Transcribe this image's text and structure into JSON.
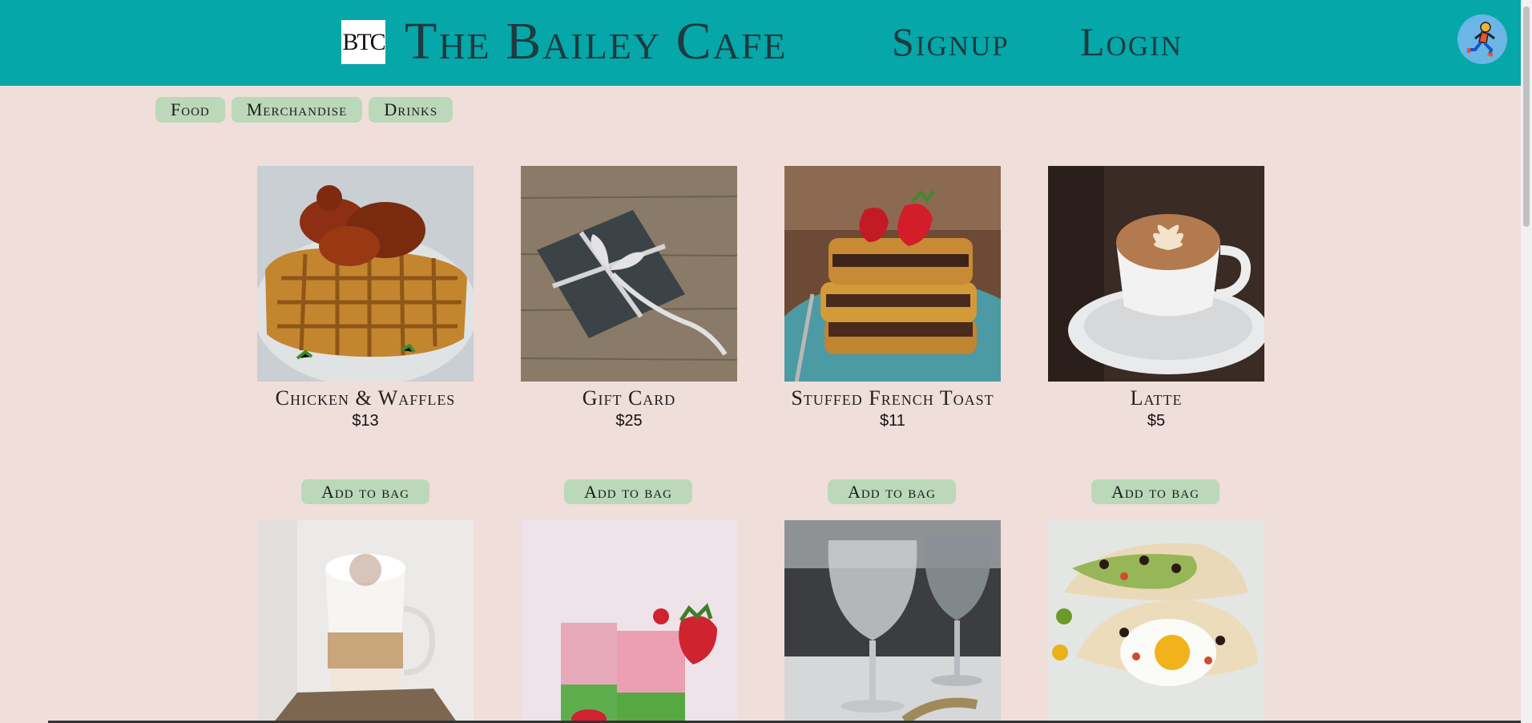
{
  "header": {
    "logo_text": "BTC",
    "site_title": "The Bailey Cafe",
    "nav": {
      "signup": "Signup",
      "login": "Login"
    },
    "avatar_icon": "running-person-icon",
    "bg_color": "#05a7a8"
  },
  "categories": [
    "Food",
    "Merchandise",
    "Drinks"
  ],
  "products": [
    {
      "name": "Chicken & Waffles",
      "price": "$13",
      "button": "Add to bag",
      "image": "chicken-and-waffles-photo"
    },
    {
      "name": "Gift Card",
      "price": "$25",
      "button": "Add to bag",
      "image": "gift-box-photo"
    },
    {
      "name": "Stuffed French Toast",
      "price": "$11",
      "button": "Add to bag",
      "image": "french-toast-photo"
    },
    {
      "name": "Latte",
      "price": "$5",
      "button": "Add to bag",
      "image": "latte-photo"
    }
  ],
  "products_row2": [
    {
      "image": "layered-latte-glass-photo"
    },
    {
      "image": "strawberry-smoothie-photo"
    },
    {
      "image": "water-glasses-photo"
    },
    {
      "image": "breakfast-tacos-photo"
    }
  ],
  "colors": {
    "page_bg": "#f0dedb",
    "button_bg": "#bbd8b9",
    "accent": "#05a7a8"
  }
}
